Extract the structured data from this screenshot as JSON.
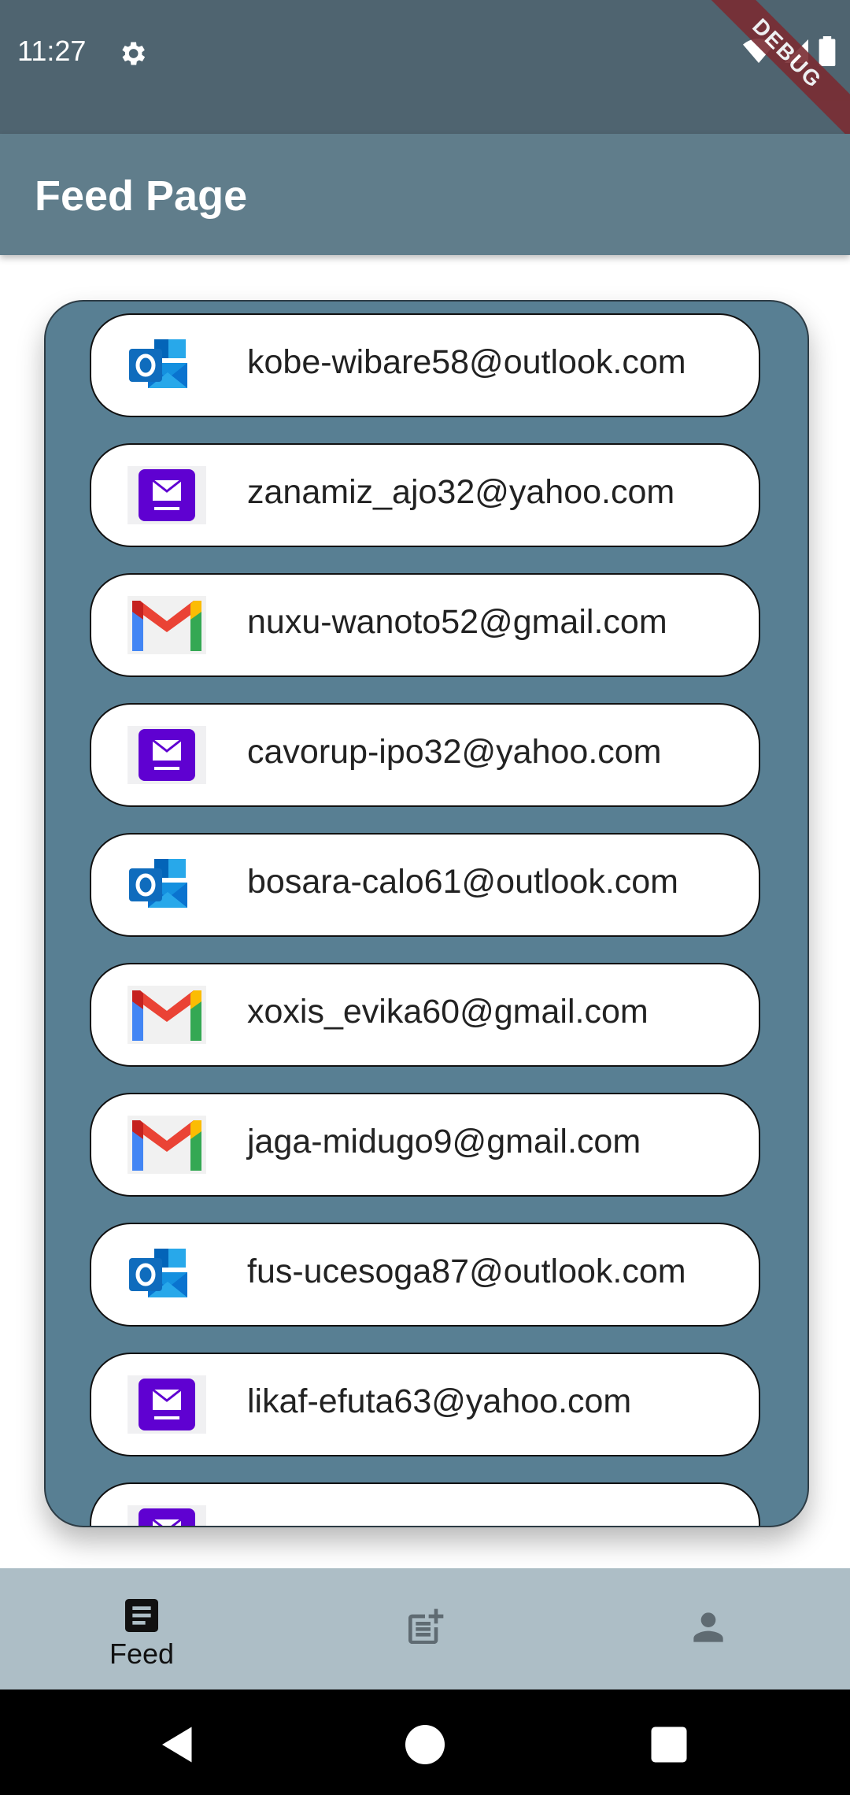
{
  "status_bar": {
    "time": "11:27",
    "icons": [
      "gear-icon",
      "wifi-icon",
      "signal-icon",
      "battery-icon"
    ],
    "debug_banner": "DEBUG"
  },
  "app_bar": {
    "title": "Feed Page",
    "color": "#607d8b"
  },
  "feed": {
    "background_color": "#587f93",
    "items": [
      {
        "provider": "outlook-icon",
        "email": "kobe-wibare58@outlook.com"
      },
      {
        "provider": "yahoo-icon",
        "email": "zanamiz_ajo32@yahoo.com"
      },
      {
        "provider": "gmail-icon",
        "email": "nuxu-wanoto52@gmail.com"
      },
      {
        "provider": "yahoo-icon",
        "email": "cavorup-ipo32@yahoo.com"
      },
      {
        "provider": "outlook-icon",
        "email": "bosara-calo61@outlook.com"
      },
      {
        "provider": "gmail-icon",
        "email": "xoxis_evika60@gmail.com"
      },
      {
        "provider": "gmail-icon",
        "email": "jaga-midugo9@gmail.com"
      },
      {
        "provider": "outlook-icon",
        "email": "fus-ucesoga87@outlook.com"
      },
      {
        "provider": "yahoo-icon",
        "email": "likaf-efuta63@yahoo.com"
      },
      {
        "provider": "yahoo-icon",
        "email": ""
      }
    ]
  },
  "bottom_nav": {
    "items": [
      {
        "icon": "article-icon",
        "label": "Feed",
        "active": true
      },
      {
        "icon": "post-add-icon",
        "label": "",
        "active": false
      },
      {
        "icon": "person-icon",
        "label": "",
        "active": false
      }
    ],
    "background_color": "#adbec6"
  },
  "system_nav": {
    "buttons": [
      "back-icon",
      "home-icon",
      "recents-icon"
    ]
  }
}
